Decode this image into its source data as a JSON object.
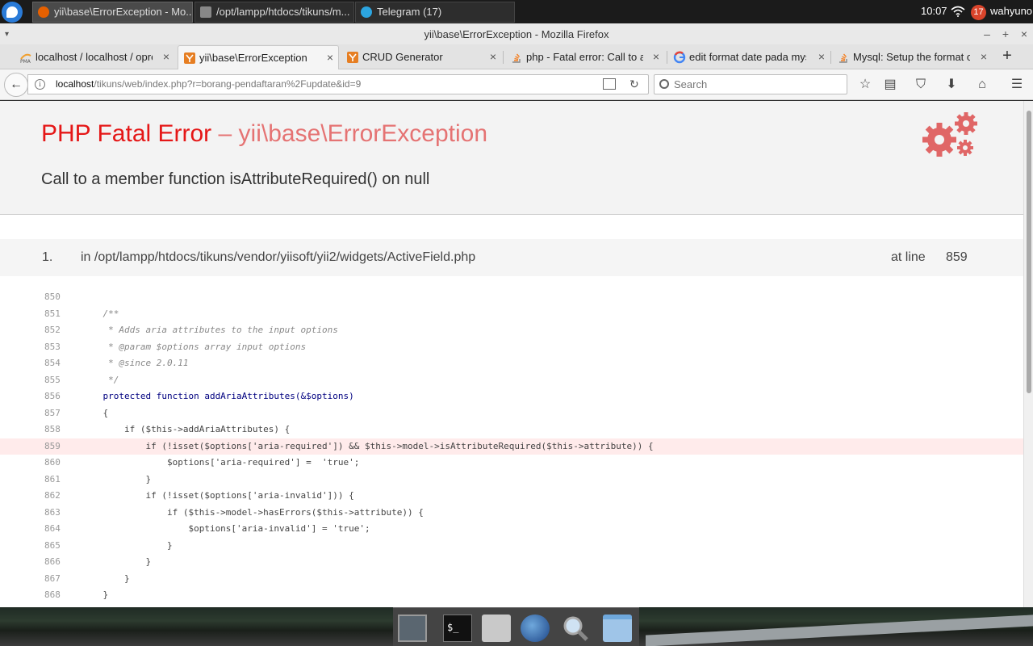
{
  "taskbar": {
    "tasks": [
      {
        "label": "yii\\base\\ErrorException - Mo..."
      },
      {
        "label": "/opt/lampp/htdocs/tikuns/m..."
      },
      {
        "label": "Telegram (17)"
      }
    ],
    "clock": "10:07",
    "notification_count": "17",
    "user": "wahyuno"
  },
  "window": {
    "title": "yii\\base\\ErrorException - Mozilla Firefox"
  },
  "tabs": [
    {
      "label": "localhost / localhost / opre",
      "selected": false
    },
    {
      "label": "yii\\base\\ErrorException",
      "selected": true
    },
    {
      "label": "CRUD Generator",
      "selected": false
    },
    {
      "label": "php - Fatal error: Call to a",
      "selected": false
    },
    {
      "label": "edit format date pada mys",
      "selected": false
    },
    {
      "label": "Mysql: Setup the format of",
      "selected": false
    }
  ],
  "toolbar": {
    "url_host": "localhost",
    "url_path": "/tikuns/web/index.php?r=borang-pendaftaran%2Fupdate&id=9",
    "search_placeholder": "Search"
  },
  "error": {
    "type": "PHP Fatal Error",
    "dash": " – ",
    "class": "yii\\base\\ErrorException",
    "message": "Call to a member function isAttributeRequired() on null"
  },
  "trace": {
    "number": "1.",
    "file": "in /opt/lampp/htdocs/tikuns/vendor/yiisoft/yii2/widgets/ActiveField.php",
    "at_label": "at line",
    "line": "859"
  },
  "code_lines": [
    {
      "n": "850",
      "t": ""
    },
    {
      "n": "851",
      "t": "    /**"
    },
    {
      "n": "852",
      "t": "     * Adds aria attributes to the input options"
    },
    {
      "n": "853",
      "t": "     * @param $options array input options"
    },
    {
      "n": "854",
      "t": "     * @since 2.0.11"
    },
    {
      "n": "855",
      "t": "     */"
    },
    {
      "n": "856",
      "t": "    protected function addAriaAttributes(&$options)"
    },
    {
      "n": "857",
      "t": "    {"
    },
    {
      "n": "858",
      "t": "        if ($this->addAriaAttributes) {"
    },
    {
      "n": "859",
      "t": "            if (!isset($options['aria-required']) && $this->model->isAttributeRequired($this->attribute)) {"
    },
    {
      "n": "860",
      "t": "                $options['aria-required'] =  'true';"
    },
    {
      "n": "861",
      "t": "            }"
    },
    {
      "n": "862",
      "t": "            if (!isset($options['aria-invalid'])) {"
    },
    {
      "n": "863",
      "t": "                if ($this->model->hasErrors($this->attribute)) {"
    },
    {
      "n": "864",
      "t": "                    $options['aria-invalid'] = 'true';"
    },
    {
      "n": "865",
      "t": "                }"
    },
    {
      "n": "866",
      "t": "            }"
    },
    {
      "n": "867",
      "t": "        }"
    },
    {
      "n": "868",
      "t": "    }"
    }
  ],
  "error_line": "859",
  "colors": {
    "error_red": "#e51717",
    "class_red": "#e57373",
    "gear_red": "#e06666",
    "highlight": "#ffebeb"
  }
}
